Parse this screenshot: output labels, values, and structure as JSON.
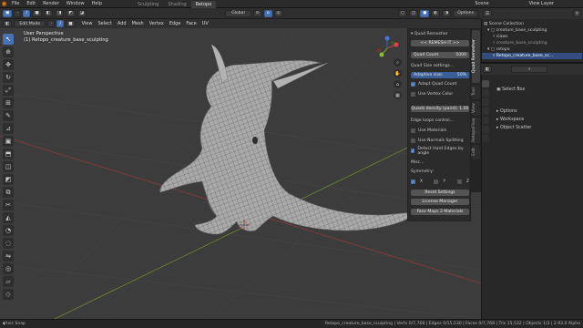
{
  "menus": [
    "File",
    "Edit",
    "Render",
    "Window",
    "Help"
  ],
  "workspace_tabs": [
    {
      "label": "Sculpting"
    },
    {
      "label": "Shading"
    },
    {
      "label": "Retopo",
      "active": true
    }
  ],
  "scene_label": "Scene",
  "view_layer_label": "View Layer",
  "toolbar": {
    "transform_orientation": "Global",
    "options_label": "Options"
  },
  "header": {
    "mode": "Edit Mode",
    "items": [
      "View",
      "Select",
      "Add",
      "Mesh",
      "Vertex",
      "Edge",
      "Face",
      "UV"
    ]
  },
  "viewport": {
    "view_name": "User Perspective",
    "object_label": "(1) Retopo_creature_base_sculpting"
  },
  "n_panel": {
    "title": "Quad Remesher",
    "remesh_button": "<< REMESH IT >>",
    "quad_count_label": "Quad Count",
    "quad_count_value": "5000",
    "quad_size_settings": "Quad Size settings...",
    "adaptive_size_label": "Adaptive size:",
    "adaptive_size_value": "50%",
    "adapt_quad_count": "Adapt Quad Count",
    "use_vertex_color": "Use Vertex Color",
    "quads_density_label": "Quads density (paint):",
    "quads_density_value": "1.00",
    "edge_loops_control": "Edge loops control...",
    "use_materials": "Use Materials",
    "use_normals_splitting": "Use Normals Splitting",
    "detect_hard_edges": "Detect Hard Edges by angle",
    "misc_label": "Misc...",
    "symmetry_label": "Symmetry:",
    "sym_x": "X",
    "sym_y": "Y",
    "sym_z": "Z",
    "reset_settings": "Reset Settings",
    "license_manager": "License Manager",
    "face_maps_materials": "Face Maps 2 Materials"
  },
  "n_tabs": [
    "Quad Remesher",
    "Tool",
    "View",
    "RetopoFlow",
    "Edit"
  ],
  "outliner": {
    "title": "Scene Collection",
    "rows": [
      {
        "label": "Scene Collection"
      },
      {
        "label": "creature_base_sculpting"
      },
      {
        "label": "claws"
      },
      {
        "label": "creature_base_sculpting"
      },
      {
        "label": "retopo"
      },
      {
        "label": "Retopo_creature_base_sc...",
        "selected": true
      }
    ]
  },
  "properties": {
    "active_tool": "Select Box",
    "sections": [
      "Options",
      "Workspace",
      "Object Scatter"
    ]
  },
  "statusbar": {
    "left": "Axis Snap",
    "right": "Retopo_creature_base_sculpting | Verts 0/7,768 | Edges 0/15,530 | Faces 0/7,768 | Tris 15,532 | Objects 1/3 | 2.93.0 Alpha"
  },
  "colors": {
    "accent": "#4772b3",
    "bg": "#3c3c3c",
    "selected": "#334d80"
  }
}
